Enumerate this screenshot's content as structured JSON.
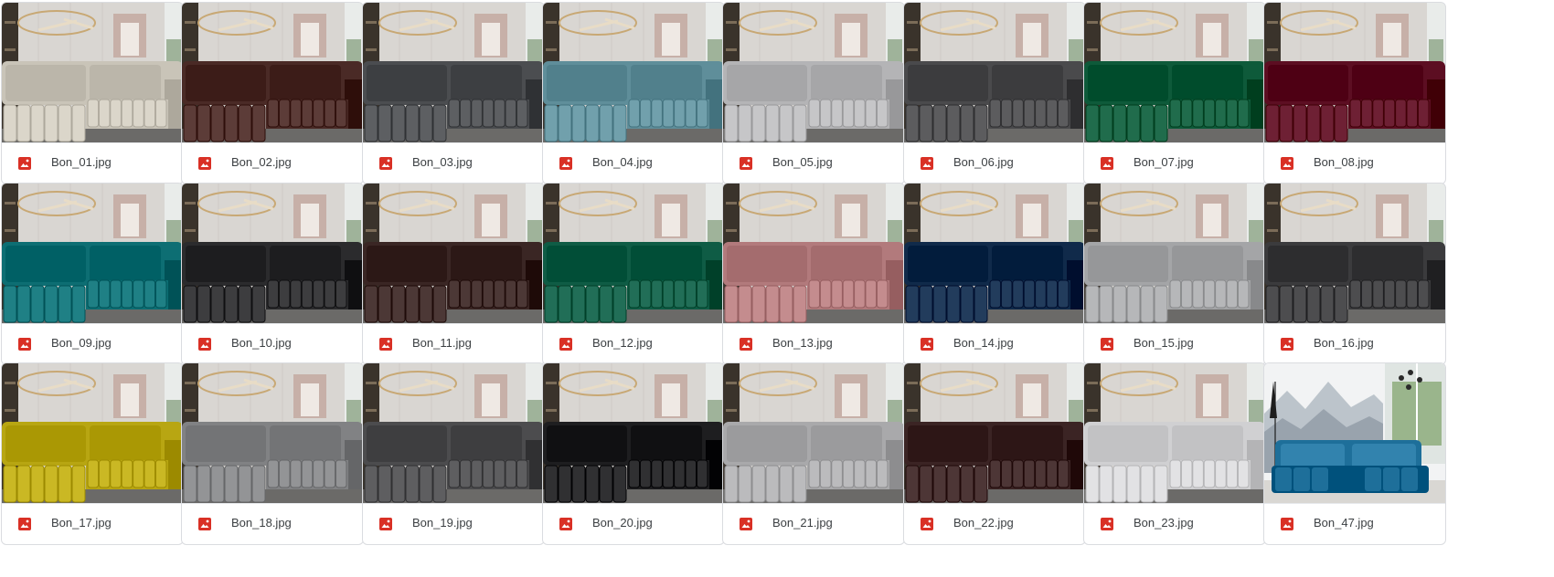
{
  "icon": "image-file-icon",
  "colors": {
    "icon_red": "#d93025",
    "wall": "#d9d6d2",
    "floor": "#6b6a68",
    "shelf": "#3a332b",
    "window": "#e9ecea"
  },
  "files": [
    {
      "name": "Bon_01.jpg",
      "sofa_color": "#c9c4b8"
    },
    {
      "name": "Bon_02.jpg",
      "sofa_color": "#4a2a26"
    },
    {
      "name": "Bon_03.jpg",
      "sofa_color": "#4b4d50"
    },
    {
      "name": "Bon_04.jpg",
      "sofa_color": "#5f8e9a"
    },
    {
      "name": "Bon_05.jpg",
      "sofa_color": "#b4b4b6"
    },
    {
      "name": "Bon_06.jpg",
      "sofa_color": "#4a4a4c"
    },
    {
      "name": "Bon_07.jpg",
      "sofa_color": "#0e5a3a"
    },
    {
      "name": "Bon_08.jpg",
      "sofa_color": "#5c0e22"
    },
    {
      "name": "Bon_09.jpg",
      "sofa_color": "#0d6e73"
    },
    {
      "name": "Bon_10.jpg",
      "sofa_color": "#2b2b2d"
    },
    {
      "name": "Bon_11.jpg",
      "sofa_color": "#3a2624"
    },
    {
      "name": "Bon_12.jpg",
      "sofa_color": "#0f5c45"
    },
    {
      "name": "Bon_13.jpg",
      "sofa_color": "#b27a7c"
    },
    {
      "name": "Bon_14.jpg",
      "sofa_color": "#102a4a"
    },
    {
      "name": "Bon_15.jpg",
      "sofa_color": "#a4a5a7"
    },
    {
      "name": "Bon_16.jpg",
      "sofa_color": "#3b3b3d"
    },
    {
      "name": "Bon_17.jpg",
      "sofa_color": "#b8a612"
    },
    {
      "name": "Bon_18.jpg",
      "sofa_color": "#818284"
    },
    {
      "name": "Bon_19.jpg",
      "sofa_color": "#4c4c4e"
    },
    {
      "name": "Bon_20.jpg",
      "sofa_color": "#1e1e20"
    },
    {
      "name": "Bon_21.jpg",
      "sofa_color": "#a9a9ab"
    },
    {
      "name": "Bon_22.jpg",
      "sofa_color": "#3b2424"
    },
    {
      "name": "Bon_23.jpg",
      "sofa_color": "#d0d0d2"
    },
    {
      "name": "Bon_47.jpg",
      "sofa_color": "#1e6f9a",
      "scene": "mountain"
    }
  ]
}
